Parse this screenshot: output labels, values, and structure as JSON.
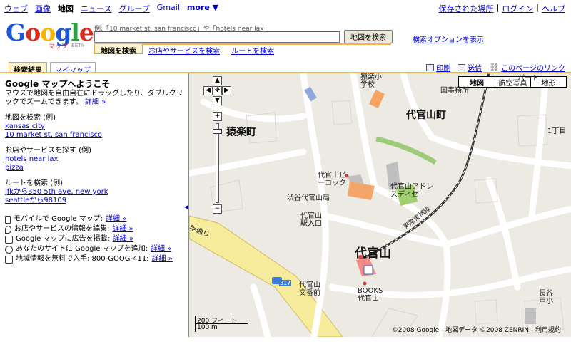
{
  "topnav": {
    "links": [
      "ウェブ",
      "画像",
      "地図",
      "ニュース",
      "グループ",
      "Gmail",
      "more ▼"
    ],
    "current": "地図",
    "saved_places": "保存された場所",
    "login": "ログイン",
    "help": "ヘルプ",
    "sep": "|"
  },
  "logo": {
    "text": "Google",
    "sub": "マップ",
    "beta": "BETA"
  },
  "search": {
    "hint": "例:「10 market st, san francisco」や「hotels near lax」",
    "value": "",
    "button": "地図を検索",
    "options": "検索オプションを表示",
    "tabs": [
      "地図を検索",
      "お店やサービスを検索",
      "ルートを検索"
    ]
  },
  "panel_tabs": [
    "検索結果",
    "マイマップ"
  ],
  "tools": {
    "print": "印刷",
    "send": "送信",
    "link": "このページのリンク"
  },
  "welcome": {
    "title": "Google マップへようこそ",
    "desc": "マウスで地図を自由自在にドラッグしたり、ダブルクリックでズームできます。",
    "more": "詳細 »"
  },
  "examples": [
    {
      "title": "地図を検索 (例)",
      "items": [
        "kansas city",
        "10 market st, san francisco"
      ]
    },
    {
      "title": "お店やサービスを探す (例)",
      "items": [
        "hotels near lax",
        "pizza"
      ]
    },
    {
      "title": "ルートを検索 (例)",
      "items": [
        "jfkから350 5th ave, new york",
        "seattleから98109"
      ]
    }
  ],
  "features": [
    {
      "icon": "mobile-icon",
      "text": "モバイルで Google マップ:",
      "link": "詳細 »"
    },
    {
      "icon": "pin-icon",
      "text": "お店やサービスの情報を編集:",
      "link": "詳細 »"
    },
    {
      "icon": "ad-icon",
      "text": "Google マップに広告を掲載:",
      "link": "詳細 »"
    },
    {
      "icon": "gear-icon",
      "text": "あなたのサイトに Google マップを追加:",
      "link": "詳細 »"
    },
    {
      "icon": "phone-icon",
      "text": "地域情報を無料で入手: 800-GOOG-411:",
      "link": "詳細 »"
    }
  ],
  "map": {
    "types": [
      "地図",
      "航空写真",
      "地形"
    ],
    "scale_ft": "200 フィート",
    "scale_m": "100 m",
    "copyright": "©2008 Google - 地図データ ©2008 ZENRIN - 利用規約",
    "labels": {
      "sarugakucho": "猿楽町",
      "daikanyamacho": "代官山町",
      "daikanyama": "代官山",
      "school": "猿楽小学校",
      "peacock": "代官山ピーコック",
      "address": "代官山アドレスディセ",
      "post": "渋谷代官山局",
      "station": "代官山駅入口",
      "koban": "代官山交番前",
      "books": "BOOKS代官山",
      "tokyu": "東急東横線",
      "road": "手通り",
      "route": "317",
      "office": "国事務所",
      "school2": "長谷戸小",
      "chome": "1丁目",
      "apart": "パート"
    }
  }
}
